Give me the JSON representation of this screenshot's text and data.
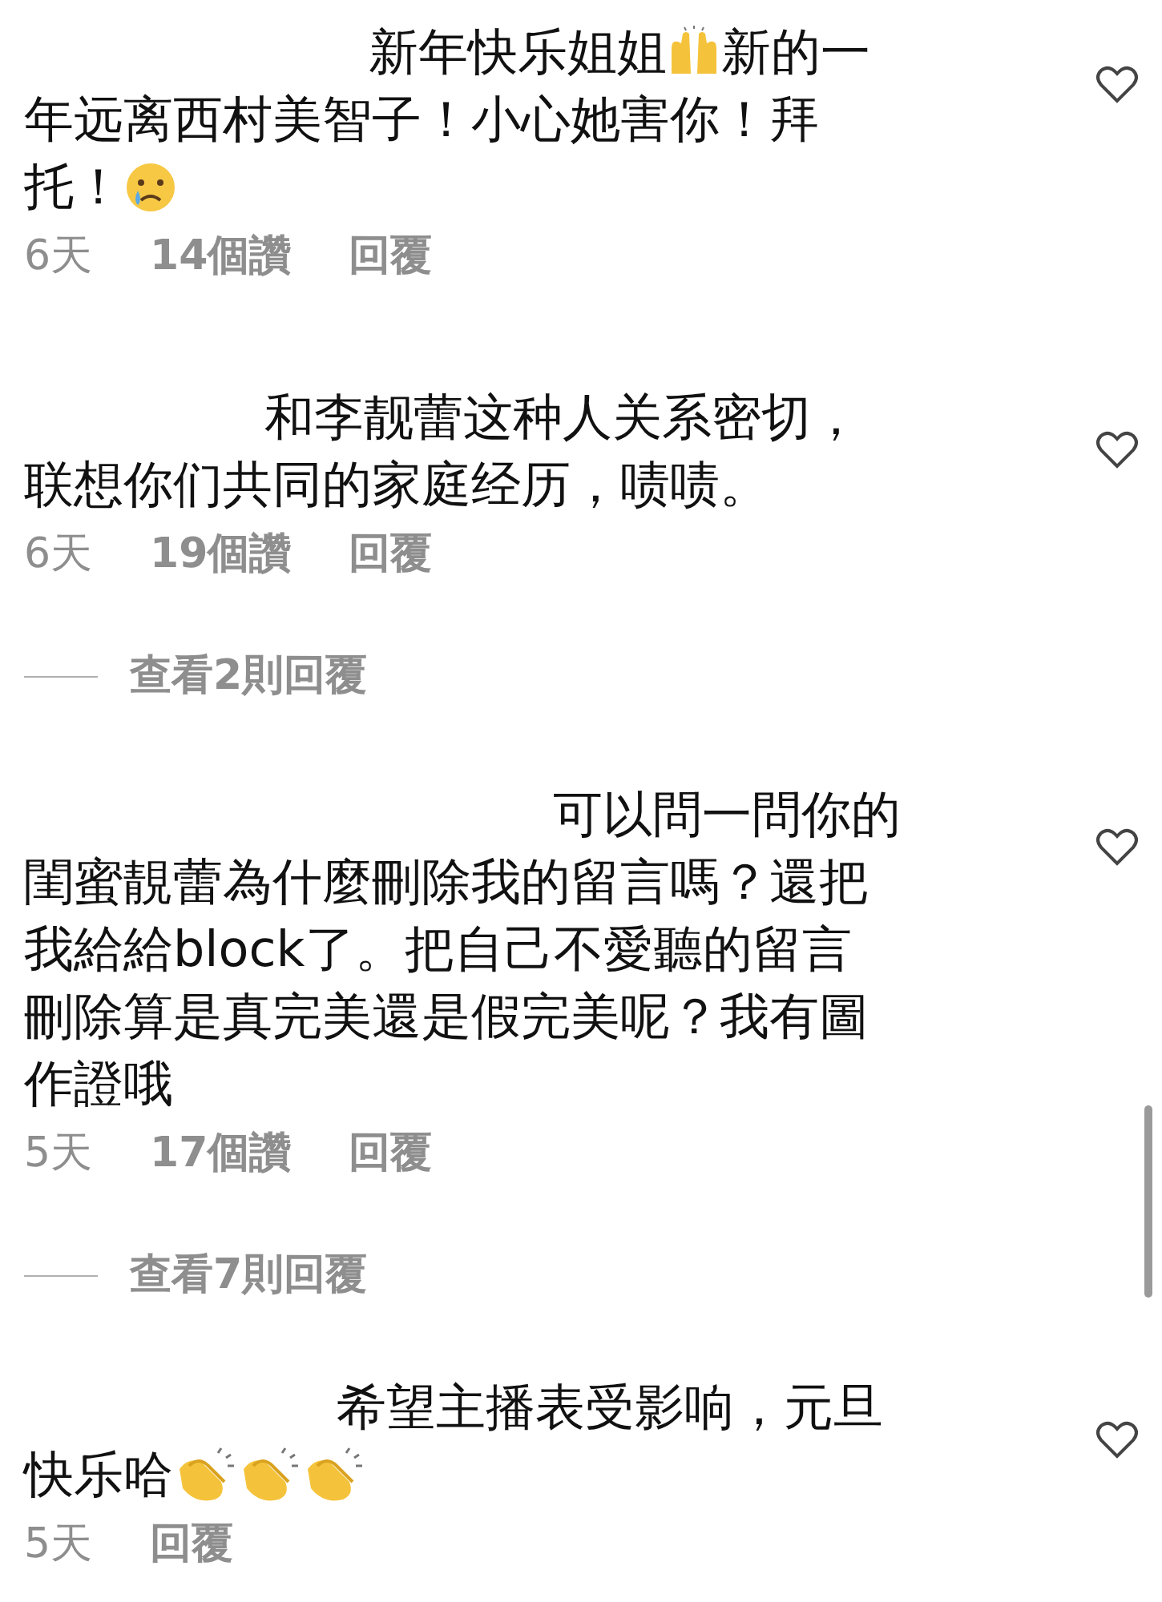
{
  "comments": [
    {
      "lines": [
        [
          {
            "kind": "text",
            "text": "新年快乐姐姐"
          },
          {
            "kind": "hands"
          },
          {
            "kind": "text",
            "text": "新的一"
          }
        ],
        [
          {
            "kind": "text",
            "text": "年远离西村美智子！小心她害你！拜"
          }
        ],
        [
          {
            "kind": "text",
            "text": "托！"
          },
          {
            "kind": "tear"
          }
        ]
      ],
      "liked": false,
      "time": "6天",
      "likes": "14個讚",
      "reply": "回覆"
    },
    {
      "lines": [
        [
          {
            "kind": "text",
            "text": "和李靓蕾这种人关系密切，"
          }
        ],
        [
          {
            "kind": "text",
            "text": "联想你们共同的家庭经历，啧啧。"
          }
        ]
      ],
      "liked": false,
      "time": "6天",
      "likes": "19個讚",
      "reply": "回覆",
      "view_replies": "查看2則回覆"
    },
    {
      "lines": [
        [
          {
            "kind": "text",
            "text": "可以問一問你的"
          }
        ],
        [
          {
            "kind": "text",
            "text": "閨蜜靚蕾為什麼刪除我的留言嗎？還把"
          }
        ],
        [
          {
            "kind": "text",
            "text": "我給給block了。把自己不愛聽的留言"
          }
        ],
        [
          {
            "kind": "text",
            "text": "刪除算是真完美還是假完美呢？我有圖"
          }
        ],
        [
          {
            "kind": "text",
            "text": "作證哦"
          }
        ]
      ],
      "liked": false,
      "time": "5天",
      "likes": "17個讚",
      "reply": "回覆",
      "view_replies": "查看7則回覆"
    },
    {
      "lines": [
        [
          {
            "kind": "text",
            "text": "希望主播表受影响，元旦"
          }
        ],
        [
          {
            "kind": "text",
            "text": "快乐哈"
          },
          {
            "kind": "clap"
          },
          {
            "kind": "clap"
          },
          {
            "kind": "clap"
          }
        ]
      ],
      "liked": false,
      "time": "5天",
      "reply": "回覆"
    }
  ]
}
